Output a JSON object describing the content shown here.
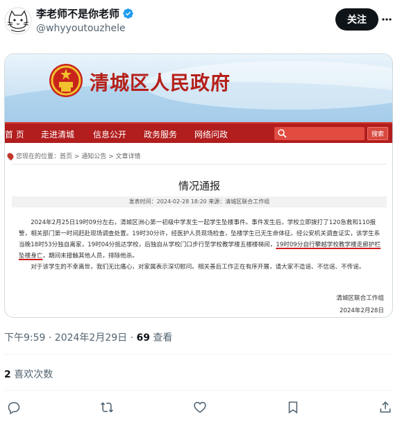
{
  "author": {
    "display_name": "李老师不是你老师",
    "handle": "@whyyoutouzhele"
  },
  "follow_label": "关注",
  "media": {
    "site_title": "清城区人民政府",
    "nav": [
      "首 页",
      "走进清城",
      "信息公开",
      "政务服务",
      "网络问政"
    ],
    "search_button": "搜索",
    "breadcrumb": "您现在的位置：首页 > 通知公告 > 文章详情",
    "article_title": "情况通报",
    "article_meta": "发表时间：2024-02-28 18:20 来源：清城区联合工作组",
    "paragraph1_a": "2024年2月25日19时09分左右，清城区洲心第一初级中学发生一起学生坠楼事件。事件发生后，学校立即拨打了120急救和110报警，相关部门第一时间赶赴现场调查处置。19时30分许，经医护人员现场检查，坠楼学生已无生命体征。经公安机关调查证实，该学生系当晚18时53分独自离家，19时04分抵达学校，后独自从学校门口步行至学校教学楼五楼楼梯间，",
    "paragraph1_highlight": "19时09分自行攀越学校教学楼走廊护栏坠楼身亡",
    "paragraph1_b": "，期间未接触其他人员，排除他杀。",
    "paragraph2": "对于该学生的不幸离世，我们无比痛心，对家属表示深切慰问。相关善后工作正在有序开展，请大家不造谣、不信谣、不传谣。",
    "signature_org": "清城区联合工作组",
    "signature_date": "2024年2月28日"
  },
  "post_time": "下午9:59 · 2024年2月29日 · ",
  "views_count": "69",
  "views_label": " 查看",
  "likes_count": "2",
  "likes_label": " 喜欢次数",
  "colors": {
    "accent_red": "#b21d1d",
    "text_primary": "#0f1419",
    "text_secondary": "#536471",
    "verified_blue": "#1d9bf0"
  },
  "icons": [
    "verified-icon",
    "more-icon",
    "reply-icon",
    "retweet-icon",
    "like-icon",
    "bookmark-icon",
    "share-icon",
    "emblem-icon",
    "search-icon"
  ]
}
